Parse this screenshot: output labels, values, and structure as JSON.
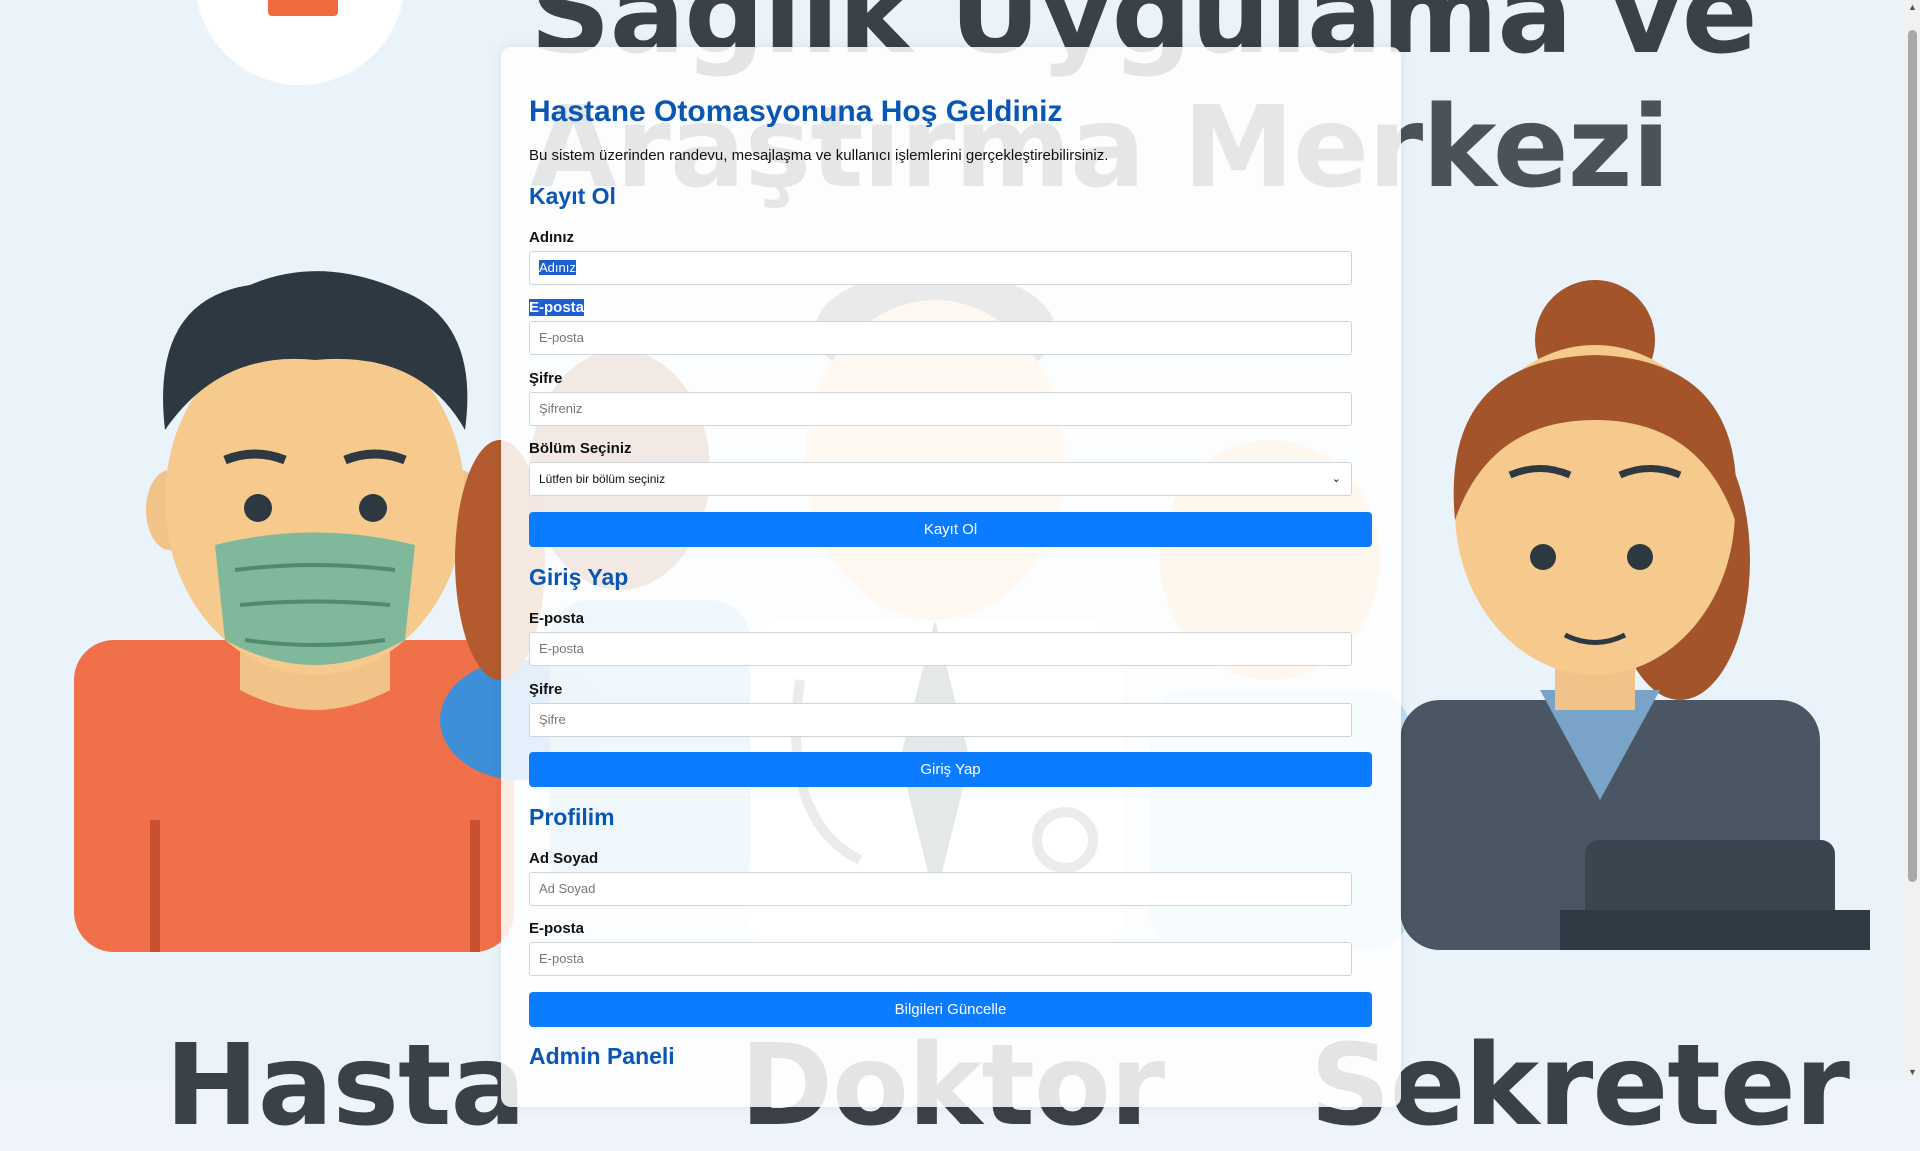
{
  "page": {
    "title": "Hastane Otomasyonuna Hoş Geldiniz",
    "intro": "Bu sistem üzerinden randevu, mesajlaşma ve kullanıcı işlemlerini gerçekleştirebilirsiniz."
  },
  "background": {
    "title_line1": "Sağlık Uygulama ve",
    "title_line2": "Araştırma Merkezi",
    "bottom_left": "Hasta",
    "bottom_mid": "Doktor",
    "bottom_right": "Sekreter"
  },
  "register": {
    "heading": "Kayıt Ol",
    "name_label": "Adınız",
    "name_placeholder": "Adınız",
    "email_label": "E-posta",
    "email_placeholder": "E-posta",
    "password_label": "Şifre",
    "password_placeholder": "Şifreniz",
    "department_label": "Bölüm Seçiniz",
    "department_selected": "Lütfen bir bölüm seçiniz",
    "submit_label": "Kayıt Ol"
  },
  "login": {
    "heading": "Giriş Yap",
    "email_label": "E-posta",
    "email_placeholder": "E-posta",
    "password_label": "Şifre",
    "password_placeholder": "Şifre",
    "submit_label": "Giriş Yap"
  },
  "profile": {
    "heading": "Profilim",
    "name_label": "Ad Soyad",
    "name_placeholder": "Ad Soyad",
    "email_label": "E-posta",
    "email_placeholder": "E-posta",
    "submit_label": "Bilgileri Güncelle"
  },
  "admin": {
    "heading": "Admin Paneli"
  },
  "icons": {
    "select_arrow": "chevron-down-icon",
    "scroll_up": "scroll-up-icon",
    "scroll_down": "scroll-down-icon"
  },
  "colors": {
    "accent": "#0b7bff",
    "heading": "#0a56b4",
    "selection": "#1b5fd3"
  }
}
